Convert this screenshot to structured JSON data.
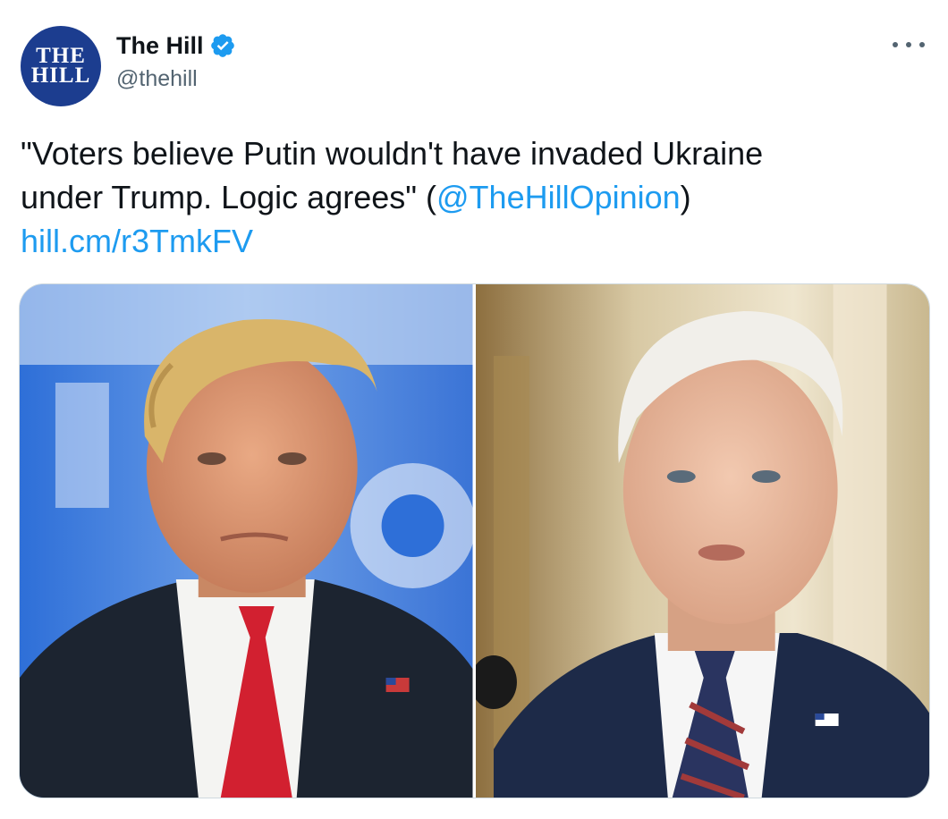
{
  "tweet": {
    "author": {
      "display_name": "The Hill",
      "handle": "@thehill",
      "avatar_logo_lines": [
        "THE",
        "HILL"
      ],
      "verified": true,
      "verified_icon": "verified-badge-icon"
    },
    "more_icon": "more-horizontal-icon",
    "text": {
      "line1": "\"Voters believe Putin wouldn't have invaded Ukraine",
      "line2_prefix": "under Trump. Logic agrees\" (",
      "mention": "@TheHillOpinion",
      "line2_suffix": ")",
      "url": "hill.cm/r3TmkFV"
    },
    "media": {
      "photos": [
        {
          "subject": "donald-trump-photo"
        },
        {
          "subject": "joe-biden-photo"
        }
      ]
    }
  },
  "colors": {
    "link": "#1d9bf0",
    "text": "#0f1419",
    "secondary": "#536471",
    "avatar_bg": "#1c3d8f",
    "border": "#cfd9de"
  }
}
